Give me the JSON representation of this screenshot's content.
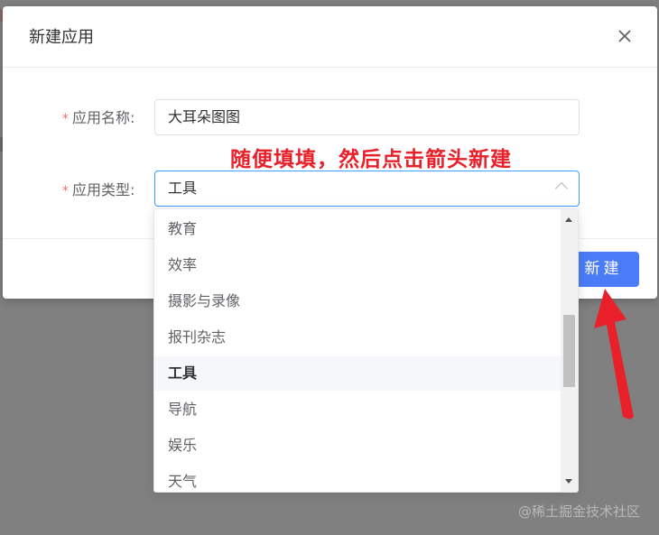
{
  "dialog": {
    "title": "新建应用",
    "close_icon": "close-icon"
  },
  "form": {
    "name_field": {
      "required_mark": "*",
      "label": "应用名称:",
      "value": "大耳朵图图"
    },
    "type_field": {
      "required_mark": "*",
      "label": "应用类型:",
      "value": "工具",
      "icon": "chevron-up-icon"
    }
  },
  "annotation": {
    "text": "随便填填，然后点击箭头新建",
    "color": "#e8202a"
  },
  "footer": {
    "create_label": "新建",
    "create_color": "#4a7cf7"
  },
  "dropdown": {
    "options": [
      {
        "label": "教育"
      },
      {
        "label": "效率"
      },
      {
        "label": "摄影与录像"
      },
      {
        "label": "报刊杂志"
      },
      {
        "label": "工具",
        "selected": true
      },
      {
        "label": "导航"
      },
      {
        "label": "娱乐"
      },
      {
        "label": "天气"
      }
    ]
  },
  "watermark": {
    "text": "@稀土掘金技术社区"
  }
}
